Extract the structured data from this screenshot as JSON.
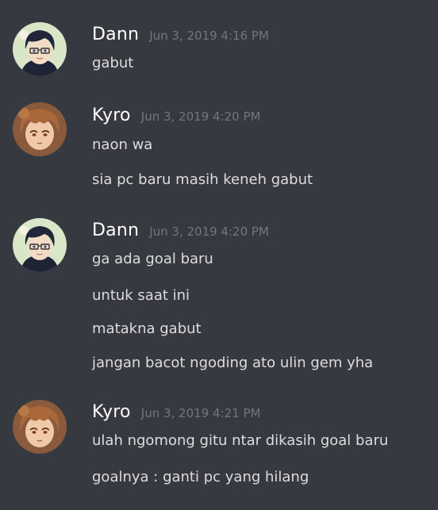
{
  "messages": [
    {
      "user": "Dann",
      "avatar_icon": "anime-boy-glasses-avatar",
      "time": "Jun 3, 2019 4:16 PM",
      "lines": [
        "gabut"
      ]
    },
    {
      "user": "Kyro",
      "avatar_icon": "anime-girl-brown-hair-avatar",
      "time": "Jun 3, 2019 4:20 PM",
      "lines": [
        "naon wa",
        "sia pc baru masih keneh gabut"
      ]
    },
    {
      "user": "Dann",
      "avatar_icon": "anime-boy-glasses-avatar",
      "time": "Jun 3, 2019 4:20 PM",
      "lines": [
        "ga ada goal baru",
        "untuk saat ini",
        "matakna gabut",
        "jangan bacot ngoding ato ulin gem yha"
      ]
    },
    {
      "user": "Kyro",
      "avatar_icon": "anime-girl-brown-hair-avatar",
      "time": "Jun 3, 2019 4:21 PM",
      "lines": [
        "ulah ngomong gitu ntar dikasih goal baru",
        "goalnya : ganti pc yang hilang"
      ]
    }
  ],
  "colors": {
    "background": "#36393f",
    "username": "#ffffff",
    "timestamp": "#72767d",
    "message_text": "#dcddde"
  }
}
